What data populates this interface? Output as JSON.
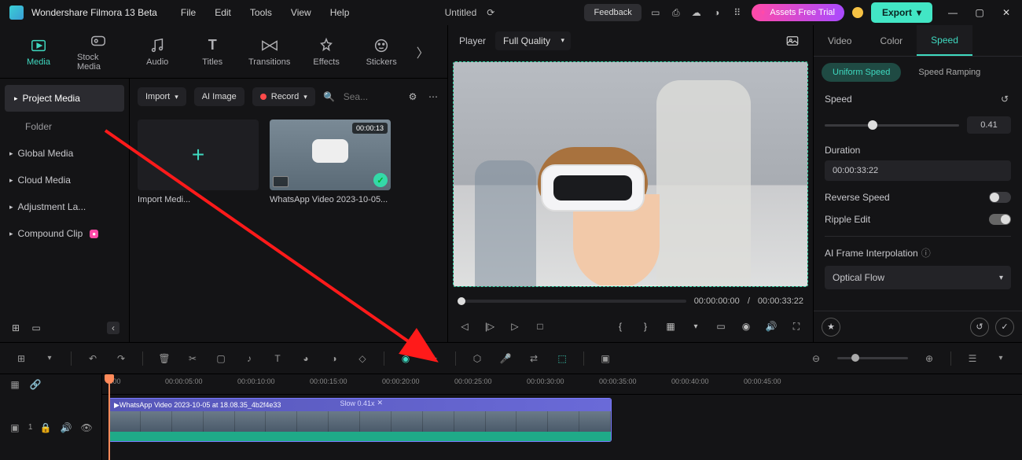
{
  "app": {
    "title": "Wondershare Filmora 13 Beta",
    "doc": "Untitled"
  },
  "menus": [
    "File",
    "Edit",
    "Tools",
    "View",
    "Help"
  ],
  "titlebar": {
    "feedback": "Feedback",
    "assets": "Assets Free Trial",
    "export": "Export"
  },
  "nav_tabs": [
    {
      "label": "Media",
      "icon": "media",
      "active": true
    },
    {
      "label": "Stock Media",
      "icon": "stock"
    },
    {
      "label": "Audio",
      "icon": "audio"
    },
    {
      "label": "Titles",
      "icon": "titles"
    },
    {
      "label": "Transitions",
      "icon": "trans"
    },
    {
      "label": "Effects",
      "icon": "fx"
    },
    {
      "label": "Stickers",
      "icon": "stick"
    }
  ],
  "sidepanel": {
    "project": "Project Media",
    "folder": "Folder",
    "items": [
      "Global Media",
      "Cloud Media",
      "Adjustment La...",
      "Compound Clip"
    ]
  },
  "media_toolbar": {
    "import": "Import",
    "ai": "AI Image",
    "record": "Record",
    "search_ph": "Sea..."
  },
  "media_cards": [
    {
      "label": "Import Medi...",
      "type": "import"
    },
    {
      "label": "WhatsApp Video 2023-10-05...",
      "type": "video",
      "dur": "00:00:13"
    }
  ],
  "preview": {
    "player": "Player",
    "quality": "Full Quality",
    "cur": "00:00:00:00",
    "total": "00:00:33:22"
  },
  "right": {
    "tabs": [
      "Video",
      "Color",
      "Speed"
    ],
    "subtabs": [
      "Uniform Speed",
      "Speed Ramping"
    ],
    "speed_label": "Speed",
    "speed_value": "0.41",
    "duration_label": "Duration",
    "duration_value": "00:00:33:22",
    "reverse": "Reverse Speed",
    "ripple": "Ripple Edit",
    "ai": "AI Frame Interpolation",
    "ai_value": "Optical Flow"
  },
  "timeline": {
    "ruler": [
      "0:00",
      "00:00:05:00",
      "00:00:10:00",
      "00:00:15:00",
      "00:00:20:00",
      "00:00:25:00",
      "00:00:30:00",
      "00:00:35:00",
      "00:00:40:00",
      "00:00:45:00"
    ],
    "clip_label": "WhatsApp Video 2023-10-05 at 18.08.35_4b2f4e33",
    "slow": "Slow 0.41x"
  }
}
